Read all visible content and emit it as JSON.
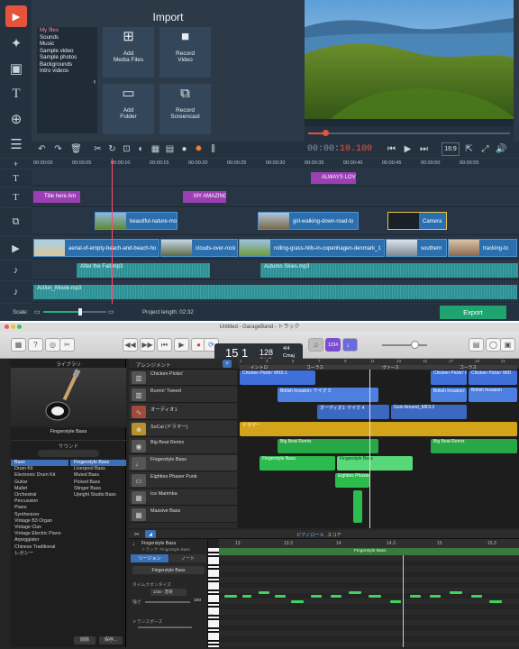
{
  "video_editor": {
    "import": {
      "title": "Import",
      "files": [
        "My files",
        "Sounds",
        "Music",
        "Sample video",
        "Sample photos",
        "Backgrounds",
        "Intro videos"
      ],
      "buttons": {
        "add_media": "Add\nMedia Files",
        "record_video": "Record\nVideo",
        "add_folder": "Add\nFolder",
        "record_screencast": "Record\nScreencast"
      }
    },
    "timecode_grey": "00:00:",
    "timecode_red": "10.100",
    "aspect": "16:9",
    "ruler_ticks": [
      "00:00:00",
      "00:00:05",
      "00:00:10",
      "00:00:15",
      "00:00:20",
      "00:00:25",
      "00:00:30",
      "00:00:35",
      "00:00:40",
      "00:00:45",
      "00:00:50",
      "00:00:55"
    ],
    "title_clips": [
      "Title here Am",
      "MY AMAZING",
      "ALWAYS LOV"
    ],
    "video_clips": [
      "beautiful-nature-mo",
      "girl-walking-down-road-to",
      "Camera",
      "aerial-of-empty-beach-and-beach-ho",
      "clouds-over-rock",
      "rolling-grass-hills-in-copenhagen-denmark_1",
      "southern",
      "tracking-to"
    ],
    "audio_clips": [
      "After the Fall.mp3",
      "Autumn Skies.mp3",
      "Action_Movie.mp3"
    ],
    "status": {
      "scale_label": "Scale:",
      "project_length": "Project length:  02:32",
      "export": "Export"
    }
  },
  "garageband": {
    "window_title": "Untitled - GarageBand - トラック",
    "lcd": {
      "bar": "15",
      "beat": "1",
      "tempo": "128",
      "tempo_label": "テンポ",
      "signature": "4/4",
      "key": "Cmaj"
    },
    "lcd_button": "1234",
    "library": {
      "header": "ライブラリ",
      "instrument_name": "Fingerstyle Bass",
      "sound_header": "サウンド",
      "categories": [
        "Bass",
        "Drum Kit",
        "Electronic Drum Kit",
        "Guitar",
        "Mallet",
        "Orchestral",
        "Percussion",
        "Piano",
        "Synthesizer",
        "Vintage B3 Organ",
        "Vintage Clav",
        "Vintage Electric Piano",
        "Arpeggiator",
        "Chinese Traditional",
        "レガシー"
      ],
      "patches": [
        "Fingerstyle Bass",
        "Liverpool Bass",
        "Muted Bass",
        "Picked Bass",
        "Stinger Bass",
        "Upright Studio Bass"
      ],
      "footer": [
        "削除",
        "保存..."
      ]
    },
    "tracks_header": "アレンジメント",
    "sections": [
      "イントロ",
      "コーラス",
      "ヴァース",
      "コーラス"
    ],
    "bar_numbers": [
      "1",
      "3",
      "5",
      "7",
      "9",
      "11",
      "13",
      "15",
      "17",
      "19",
      "21"
    ],
    "tracks": [
      "Chicken Pickin'",
      "Burnin' Tweed",
      "オーディオ1",
      "SoCal (ドラマー)",
      "Big Beat Remix",
      "Fingerstyle Bass",
      "Eighties Phaser Punk",
      "Ice Marimba",
      "Massive Bass"
    ],
    "regions": [
      "Chicken Pickin' MIDI.1",
      "Chicken Pickin' MIDI",
      "Chicken Pickin' MID",
      "British Invasion: テイク 3",
      "British Invasion: テイク",
      "British Invasion",
      "オーディオ1: テイク 4",
      "Goin Around_MIDI.2",
      "ドラマー",
      "Big Beat Remix",
      "Big Beat Remix",
      "Fingerstyle Bass",
      "Fingerstyle Bass",
      "Eighties Phaser Punk"
    ],
    "editor": {
      "tabs": [
        "ピアノロール",
        "スコア"
      ],
      "track_name": "Fingerstyle Bass",
      "track_sub": "トラック: Fingerstyle Bass",
      "region_tab": "リージョン",
      "note_tab": "ノート",
      "region_name_field": "Fingerstyle Bass",
      "time_quantize_label": "タイムクオンタイズ",
      "quantize_value": "1/16 - 音符",
      "strength_label": "強さ",
      "strength_value": "100",
      "transpose_label": "トランスポーズ",
      "bars": [
        "13",
        "13.3",
        "14",
        "14.3",
        "15",
        "15.3"
      ],
      "region_label": "Fingerstyle Bass",
      "key_label": "C2"
    }
  }
}
